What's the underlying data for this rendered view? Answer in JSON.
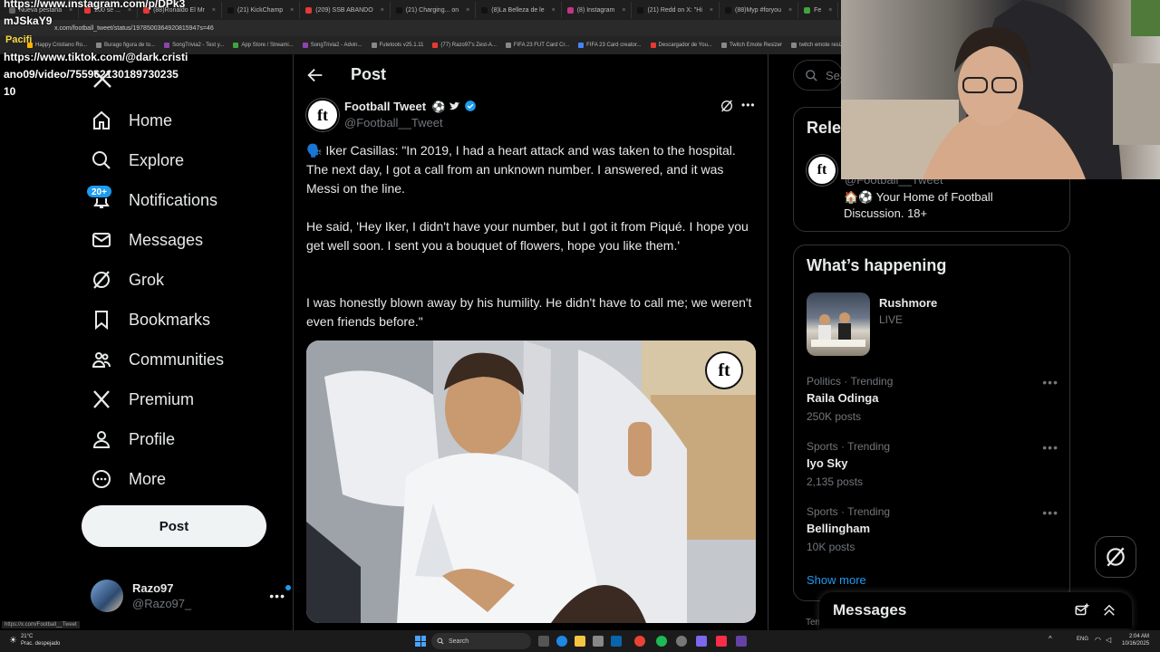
{
  "browser": {
    "tabs": [
      {
        "label": "Nueva pestaña",
        "color": "#666"
      },
      {
        "label": "200 se ...",
        "color": "#e53935"
      },
      {
        "label": "(88)Ronaldo El Mr",
        "color": "#e53935"
      },
      {
        "label": "(21) KickChamp",
        "color": "#111"
      },
      {
        "label": "(209) SSB ABANDO",
        "color": "#e53935"
      },
      {
        "label": "(21) Charging... on",
        "color": "#111"
      },
      {
        "label": "(8)La Belleza de le",
        "color": "#111"
      },
      {
        "label": "(8) Instagram",
        "color": "#c13584"
      },
      {
        "label": "(21) Redd on X: \"Hi",
        "color": "#111"
      },
      {
        "label": "(88)Myp #foryou",
        "color": "#111"
      },
      {
        "label": "Fe",
        "color": "#3fa53f"
      }
    ],
    "url": "x.com/football_tweet/status/1978500364920815947s=46",
    "bookmarks": [
      {
        "label": "Happy Cristiano Ro...",
        "color": "#ffb300"
      },
      {
        "label": "Burago figura de to...",
        "color": "#888"
      },
      {
        "label": "SongTrivia2 - Test y...",
        "color": "#8e44ad"
      },
      {
        "label": "App Store / Streami...",
        "color": "#3fa53f"
      },
      {
        "label": "SongTrivia2 - Advin...",
        "color": "#8e44ad"
      },
      {
        "label": "Futetools v25.1.11",
        "color": "#888"
      },
      {
        "label": "(77) Razo97's Zest-A...",
        "color": "#e53935"
      },
      {
        "label": "FIFA 23 FUT Card Cr...",
        "color": "#888"
      },
      {
        "label": "FIFA 23 Card creator...",
        "color": "#4285f4"
      },
      {
        "label": "Descargador de You...",
        "color": "#e53935"
      },
      {
        "label": "Twitch Emote Resizer",
        "color": "#888"
      },
      {
        "label": "twitch emote resizer",
        "color": "#888"
      }
    ]
  },
  "overlays": {
    "instagram_line1": "https://www.instagram.com/p/DPk3",
    "instagram_line2": "mJSkaY9",
    "tiktok_line1": "https://www.tiktok.com/@dark.cristi",
    "tiktok_line2": "ano09/video/755962130189730235",
    "tiktok_line3": "10",
    "yellow_text": "Pacifi"
  },
  "nav": {
    "items": [
      {
        "label": "Home",
        "icon": "home-icon"
      },
      {
        "label": "Explore",
        "icon": "search-icon"
      },
      {
        "label": "Notifications",
        "icon": "bell-icon",
        "badge": "20+"
      },
      {
        "label": "Messages",
        "icon": "mail-icon"
      },
      {
        "label": "Grok",
        "icon": "grok-icon"
      },
      {
        "label": "Bookmarks",
        "icon": "bookmark-icon"
      },
      {
        "label": "Communities",
        "icon": "communities-icon"
      },
      {
        "label": "Premium",
        "icon": "x-logo-icon"
      },
      {
        "label": "Profile",
        "icon": "person-icon"
      },
      {
        "label": "More",
        "icon": "more-circle-icon"
      }
    ],
    "post_button": "Post",
    "account": {
      "name": "Razo97",
      "handle": "@Razo97_"
    }
  },
  "post": {
    "header_title": "Post",
    "author_name": "Football Tweet",
    "author_handle": "@Football__Tweet",
    "avatar_text": "ft",
    "paragraphs": [
      "🗣️ Iker Casillas: \"In 2019, I had a heart attack and was taken to the hospital. The next day, I got a call from an unknown number. I answered, and it was Messi on the line.",
      "He said, 'Hey Iker, I didn't have your number, but I got it from Piqué. I hope you get well soon. I sent you a bouquet of flowers, hope you like them.'",
      "I was honestly blown away by his humility. He didn't have to call me; we weren't even friends before.\""
    ]
  },
  "right": {
    "search_placeholder": "Sear",
    "relevant_title": "Rele",
    "relevant_handle": "@Football__Tweet",
    "relevant_bio": "🏠⚽ Your Home of Football Discussion. 18+",
    "happening_title": "What’s happening",
    "live": {
      "name": "Rushmore",
      "status": "LIVE"
    },
    "trends": [
      {
        "meta": "Politics · Trending",
        "name": "Raila Odinga",
        "count": "250K posts"
      },
      {
        "meta": "Sports · Trending",
        "name": "Iyo Sky",
        "count": "2,135 posts"
      },
      {
        "meta": "Sports · Trending",
        "name": "Bellingham",
        "count": "10K posts"
      }
    ],
    "show_more": "Show more",
    "footer_fragment": "Terr",
    "messages_label": "Messages"
  },
  "taskbar": {
    "weather_temp": "21°C",
    "weather_desc": "Prac. despejado",
    "search_label": "Search",
    "lang": "ENG",
    "time": "2:04 AM",
    "date": "10/16/2025"
  },
  "status_url": "https://x.com/Football__Tweet",
  "colors": {
    "accent": "#1d9bf0",
    "background": "#000000",
    "muted": "#71767b"
  }
}
